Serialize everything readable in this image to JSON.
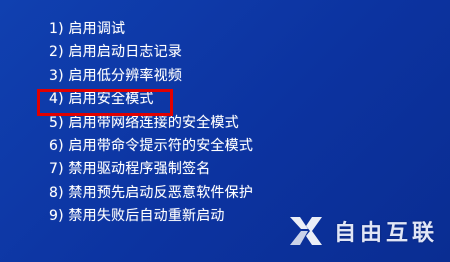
{
  "startup_options": [
    {
      "label": "1) 启用调试"
    },
    {
      "label": "2) 启用启动日志记录"
    },
    {
      "label": "3) 启用低分辨率视频"
    },
    {
      "label": "4) 启用安全模式"
    },
    {
      "label": "5) 启用带网络连接的安全模式"
    },
    {
      "label": "6) 启用带命令提示符的安全模式"
    },
    {
      "label": "7) 禁用驱动程序强制签名"
    },
    {
      "label": "8) 禁用预先启动反恶意软件保护"
    },
    {
      "label": "9) 禁用失败后自动重新启动"
    }
  ],
  "highlighted_option_index": 3,
  "watermark": {
    "text": "自由互联",
    "icon": "x-logo-icon"
  },
  "colors": {
    "background": "#0f37a0",
    "text": "#ffffff",
    "highlight_border": "#e00000"
  }
}
